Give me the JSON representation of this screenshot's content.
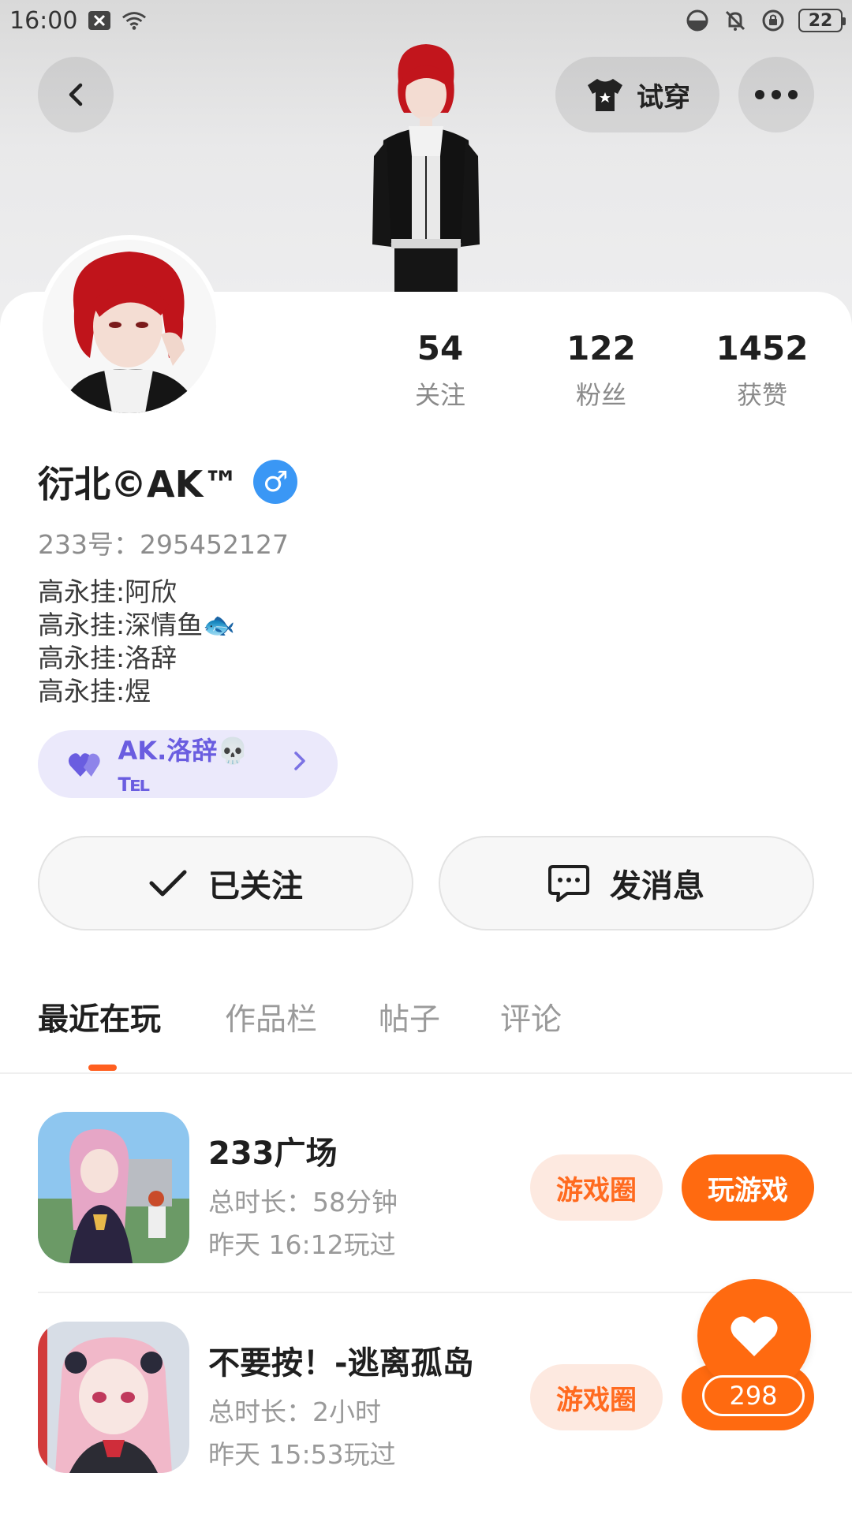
{
  "status_bar": {
    "time": "16:00",
    "battery": "22"
  },
  "header": {
    "tryon_label": "试穿"
  },
  "stats": [
    {
      "value": "54",
      "label": "关注"
    },
    {
      "value": "122",
      "label": "粉丝"
    },
    {
      "value": "1452",
      "label": "获赞"
    }
  ],
  "profile": {
    "name": "衍北©AK™",
    "gender_symbol": "♂",
    "id_line": "233号：295452127",
    "bio": [
      "高永挂:阿欣",
      "高永挂:深情鱼🐟",
      "高永挂:洛辞",
      "高永挂:煜"
    ]
  },
  "relation": {
    "label": "AK.洛辞💀℡"
  },
  "actions": {
    "follow_label": "已关注",
    "message_label": "发消息"
  },
  "tabs": [
    "最近在玩",
    "作品栏",
    "帖子",
    "评论"
  ],
  "games": [
    {
      "title": "233广场",
      "duration": "总时长：58分钟",
      "last_played": "昨天 16:12玩过",
      "circle_label": "游戏圈",
      "play_label": "玩游戏"
    },
    {
      "title": "不要按！-逃离孤岛",
      "duration": "总时长：2小时",
      "last_played": "昨天 15:53玩过",
      "circle_label": "游戏圈"
    }
  ],
  "like": {
    "count": "298"
  },
  "colors": {
    "accent": "#ff6a10",
    "relation_purple": "#6a5de0",
    "gender_blue": "#3a97f5"
  }
}
